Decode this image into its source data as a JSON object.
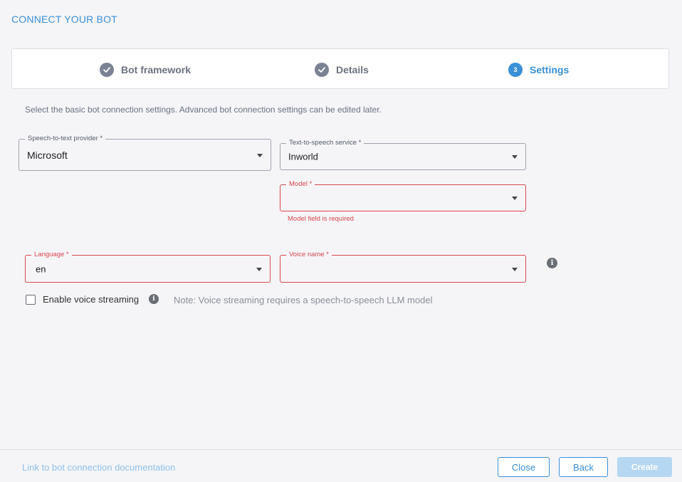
{
  "dialog": {
    "title": "CONNECT YOUR BOT"
  },
  "stepper": {
    "steps": [
      {
        "label": "Bot framework",
        "state": "completed"
      },
      {
        "label": "Details",
        "state": "completed"
      },
      {
        "label": "Settings",
        "state": "active",
        "number": "3"
      }
    ]
  },
  "intro_text": "Select the basic bot connection settings. Advanced bot connection settings can be edited later.",
  "fields": {
    "stt_provider": {
      "label": "Speech-to-text provider *",
      "value": "Microsoft"
    },
    "tts_service": {
      "label": "Text-to-speech service *",
      "value": "Inworld"
    },
    "model": {
      "label": "Model *",
      "value": "",
      "error": "Model field is required"
    },
    "language": {
      "label": "Language *",
      "value": "en"
    },
    "voice_name": {
      "label": "Voice name *",
      "value": ""
    }
  },
  "voice_streaming": {
    "checkbox_label": "Enable voice streaming",
    "checked": false,
    "note": "Note: Voice streaming requires a speech-to-speech LLM model"
  },
  "info_glyph": "i",
  "footer": {
    "doc_link": "Link to bot connection documentation",
    "close_label": "Close",
    "back_label": "Back",
    "create_label": "Create"
  },
  "colors": {
    "accent": "#3a8fd6",
    "error": "#d8474c",
    "background": "#f5f5f8",
    "disabled_button": "#b6d7f1"
  }
}
